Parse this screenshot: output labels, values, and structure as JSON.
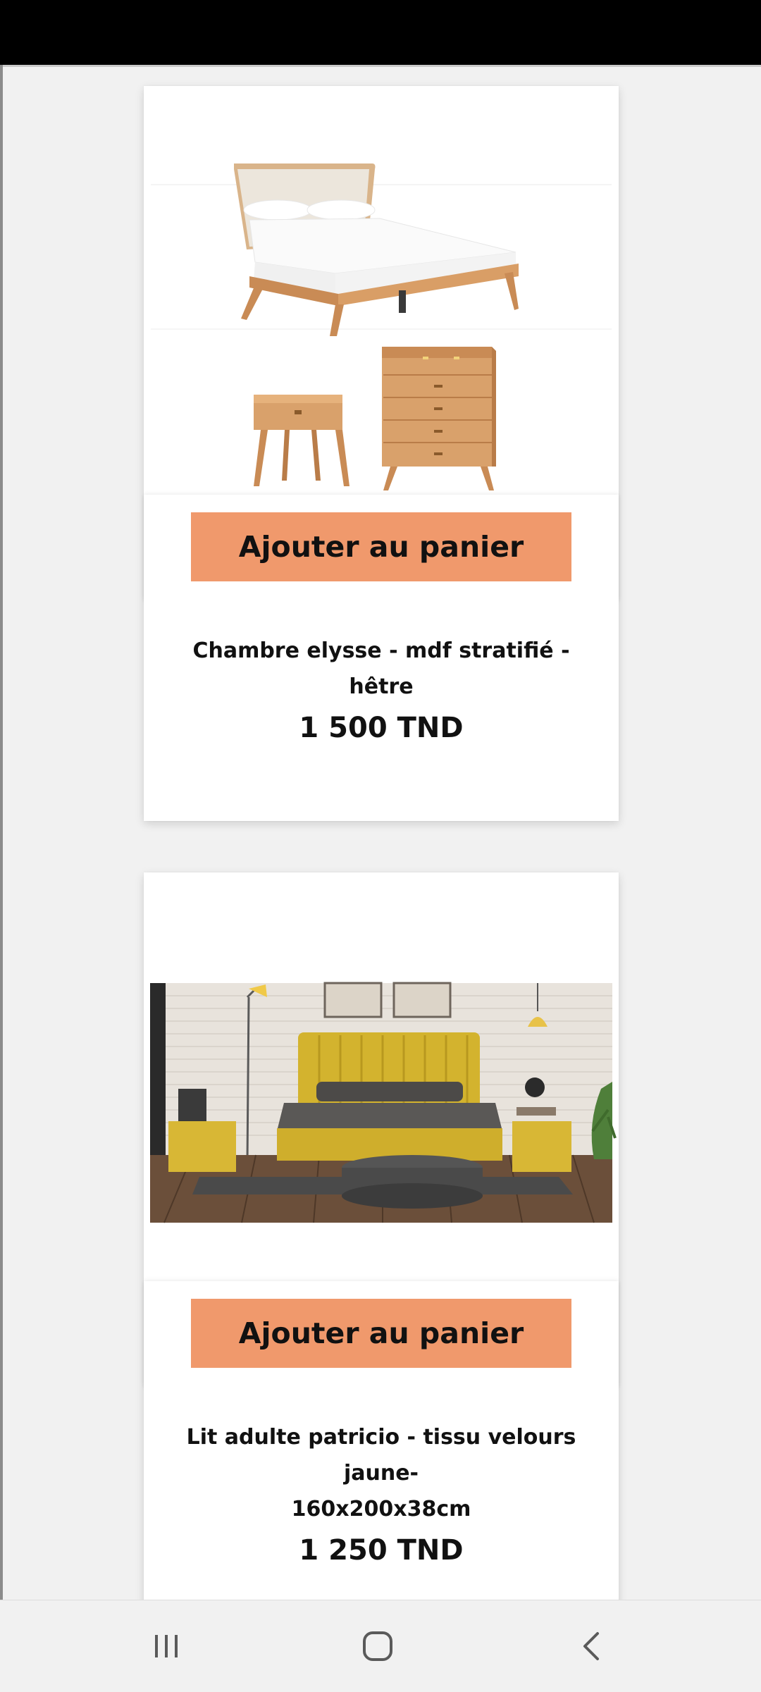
{
  "products": [
    {
      "image_alt": "bedroom-set-photo",
      "cart_label": "Ajouter au panier",
      "title": "Chambre elysse - mdf stratifié - hêtre",
      "price": "1 500 TND"
    },
    {
      "image_alt": "yellow-bed-room-photo",
      "cart_label": "Ajouter au panier",
      "title_line1": "Lit adulte patricio - tissu velours jaune-",
      "title_line2": "160x200x38cm",
      "price": "1 250 TND"
    }
  ],
  "colors": {
    "cart_button": "#f0996c",
    "page_background": "#f1f1f1",
    "status_bar": "#000000"
  },
  "nav_bar": {
    "recents_icon": "recent-apps-icon",
    "home_icon": "home-icon",
    "back_icon": "back-icon"
  }
}
